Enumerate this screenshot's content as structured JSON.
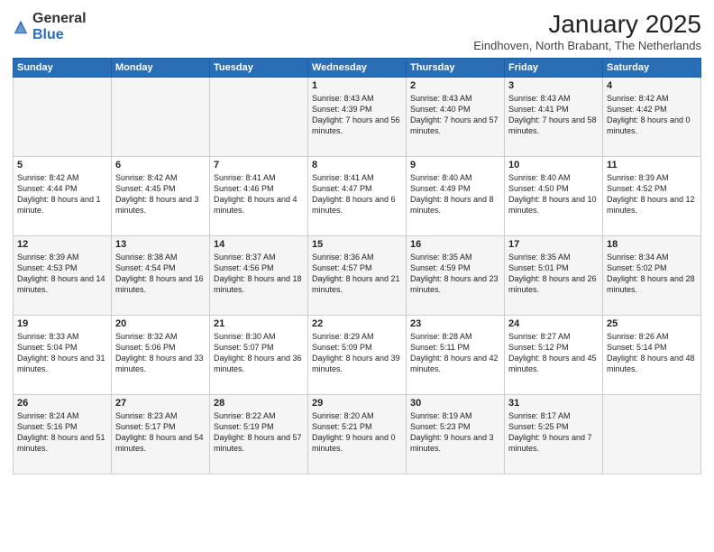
{
  "header": {
    "logo_general": "General",
    "logo_blue": "Blue",
    "month_year": "January 2025",
    "location": "Eindhoven, North Brabant, The Netherlands"
  },
  "weekdays": [
    "Sunday",
    "Monday",
    "Tuesday",
    "Wednesday",
    "Thursday",
    "Friday",
    "Saturday"
  ],
  "rows": [
    [
      {
        "day": "",
        "info": ""
      },
      {
        "day": "",
        "info": ""
      },
      {
        "day": "",
        "info": ""
      },
      {
        "day": "1",
        "info": "Sunrise: 8:43 AM\nSunset: 4:39 PM\nDaylight: 7 hours\nand 56 minutes."
      },
      {
        "day": "2",
        "info": "Sunrise: 8:43 AM\nSunset: 4:40 PM\nDaylight: 7 hours\nand 57 minutes."
      },
      {
        "day": "3",
        "info": "Sunrise: 8:43 AM\nSunset: 4:41 PM\nDaylight: 7 hours\nand 58 minutes."
      },
      {
        "day": "4",
        "info": "Sunrise: 8:42 AM\nSunset: 4:42 PM\nDaylight: 8 hours\nand 0 minutes."
      }
    ],
    [
      {
        "day": "5",
        "info": "Sunrise: 8:42 AM\nSunset: 4:44 PM\nDaylight: 8 hours\nand 1 minute."
      },
      {
        "day": "6",
        "info": "Sunrise: 8:42 AM\nSunset: 4:45 PM\nDaylight: 8 hours\nand 3 minutes."
      },
      {
        "day": "7",
        "info": "Sunrise: 8:41 AM\nSunset: 4:46 PM\nDaylight: 8 hours\nand 4 minutes."
      },
      {
        "day": "8",
        "info": "Sunrise: 8:41 AM\nSunset: 4:47 PM\nDaylight: 8 hours\nand 6 minutes."
      },
      {
        "day": "9",
        "info": "Sunrise: 8:40 AM\nSunset: 4:49 PM\nDaylight: 8 hours\nand 8 minutes."
      },
      {
        "day": "10",
        "info": "Sunrise: 8:40 AM\nSunset: 4:50 PM\nDaylight: 8 hours\nand 10 minutes."
      },
      {
        "day": "11",
        "info": "Sunrise: 8:39 AM\nSunset: 4:52 PM\nDaylight: 8 hours\nand 12 minutes."
      }
    ],
    [
      {
        "day": "12",
        "info": "Sunrise: 8:39 AM\nSunset: 4:53 PM\nDaylight: 8 hours\nand 14 minutes."
      },
      {
        "day": "13",
        "info": "Sunrise: 8:38 AM\nSunset: 4:54 PM\nDaylight: 8 hours\nand 16 minutes."
      },
      {
        "day": "14",
        "info": "Sunrise: 8:37 AM\nSunset: 4:56 PM\nDaylight: 8 hours\nand 18 minutes."
      },
      {
        "day": "15",
        "info": "Sunrise: 8:36 AM\nSunset: 4:57 PM\nDaylight: 8 hours\nand 21 minutes."
      },
      {
        "day": "16",
        "info": "Sunrise: 8:35 AM\nSunset: 4:59 PM\nDaylight: 8 hours\nand 23 minutes."
      },
      {
        "day": "17",
        "info": "Sunrise: 8:35 AM\nSunset: 5:01 PM\nDaylight: 8 hours\nand 26 minutes."
      },
      {
        "day": "18",
        "info": "Sunrise: 8:34 AM\nSunset: 5:02 PM\nDaylight: 8 hours\nand 28 minutes."
      }
    ],
    [
      {
        "day": "19",
        "info": "Sunrise: 8:33 AM\nSunset: 5:04 PM\nDaylight: 8 hours\nand 31 minutes."
      },
      {
        "day": "20",
        "info": "Sunrise: 8:32 AM\nSunset: 5:06 PM\nDaylight: 8 hours\nand 33 minutes."
      },
      {
        "day": "21",
        "info": "Sunrise: 8:30 AM\nSunset: 5:07 PM\nDaylight: 8 hours\nand 36 minutes."
      },
      {
        "day": "22",
        "info": "Sunrise: 8:29 AM\nSunset: 5:09 PM\nDaylight: 8 hours\nand 39 minutes."
      },
      {
        "day": "23",
        "info": "Sunrise: 8:28 AM\nSunset: 5:11 PM\nDaylight: 8 hours\nand 42 minutes."
      },
      {
        "day": "24",
        "info": "Sunrise: 8:27 AM\nSunset: 5:12 PM\nDaylight: 8 hours\nand 45 minutes."
      },
      {
        "day": "25",
        "info": "Sunrise: 8:26 AM\nSunset: 5:14 PM\nDaylight: 8 hours\nand 48 minutes."
      }
    ],
    [
      {
        "day": "26",
        "info": "Sunrise: 8:24 AM\nSunset: 5:16 PM\nDaylight: 8 hours\nand 51 minutes."
      },
      {
        "day": "27",
        "info": "Sunrise: 8:23 AM\nSunset: 5:17 PM\nDaylight: 8 hours\nand 54 minutes."
      },
      {
        "day": "28",
        "info": "Sunrise: 8:22 AM\nSunset: 5:19 PM\nDaylight: 8 hours\nand 57 minutes."
      },
      {
        "day": "29",
        "info": "Sunrise: 8:20 AM\nSunset: 5:21 PM\nDaylight: 9 hours\nand 0 minutes."
      },
      {
        "day": "30",
        "info": "Sunrise: 8:19 AM\nSunset: 5:23 PM\nDaylight: 9 hours\nand 3 minutes."
      },
      {
        "day": "31",
        "info": "Sunrise: 8:17 AM\nSunset: 5:25 PM\nDaylight: 9 hours\nand 7 minutes."
      },
      {
        "day": "",
        "info": ""
      }
    ]
  ]
}
